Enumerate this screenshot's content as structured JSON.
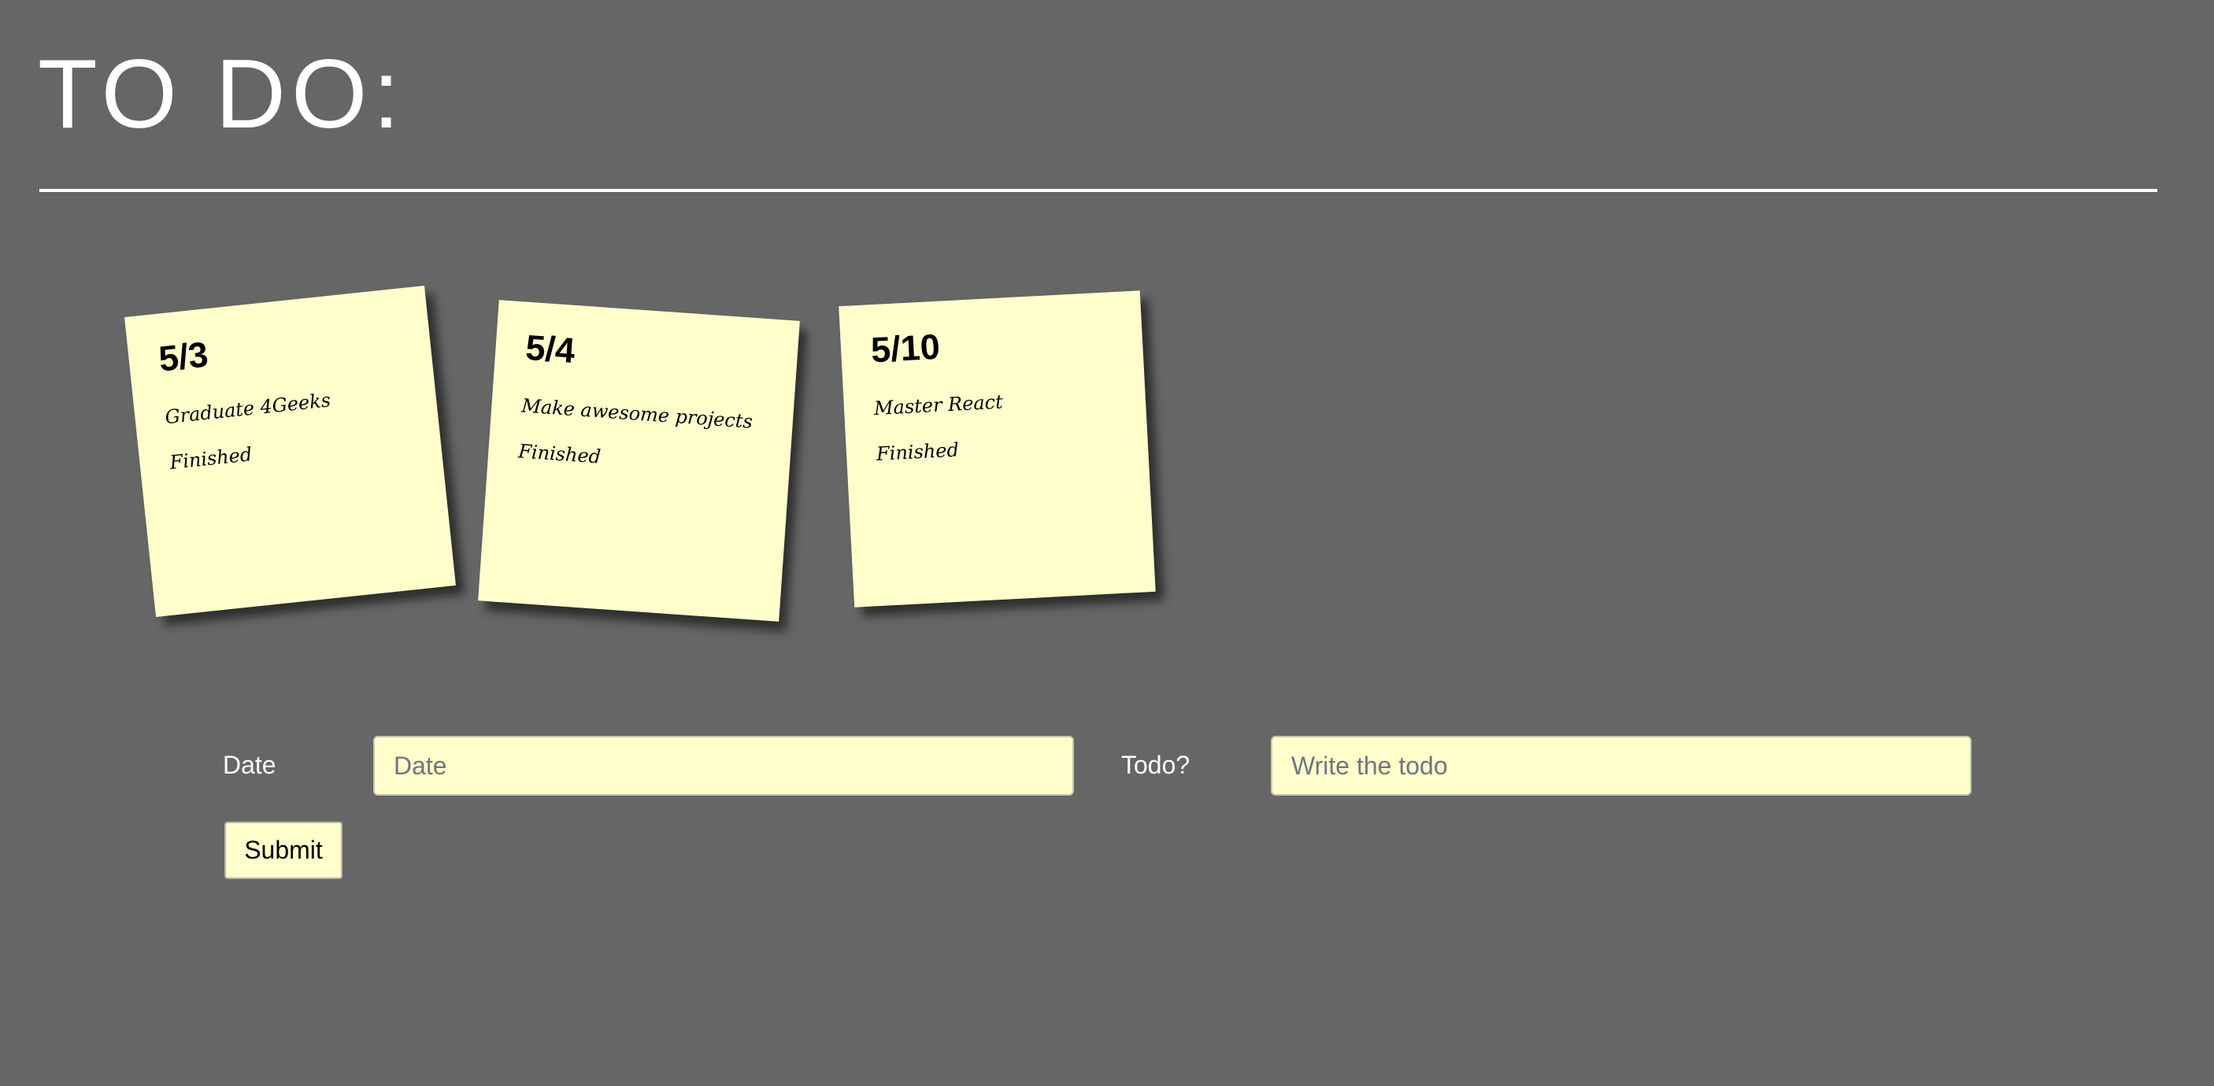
{
  "header": {
    "title": "TO DO:"
  },
  "notes": [
    {
      "date": "5/3",
      "text": "Graduate 4Geeks",
      "status": "Finished"
    },
    {
      "date": "5/4",
      "text": "Make awesome projects",
      "status": "Finished"
    },
    {
      "date": "5/10",
      "text": "Master React",
      "status": "Finished"
    }
  ],
  "form": {
    "date_label": "Date",
    "date_placeholder": "Date",
    "date_value": "",
    "todo_label": "Todo?",
    "todo_placeholder": "Write the todo",
    "todo_value": "",
    "submit_label": "Submit"
  },
  "colors": {
    "background": "#666666",
    "note": "#ffffcc",
    "text_light": "#ffffff",
    "text_dark": "#000000"
  }
}
